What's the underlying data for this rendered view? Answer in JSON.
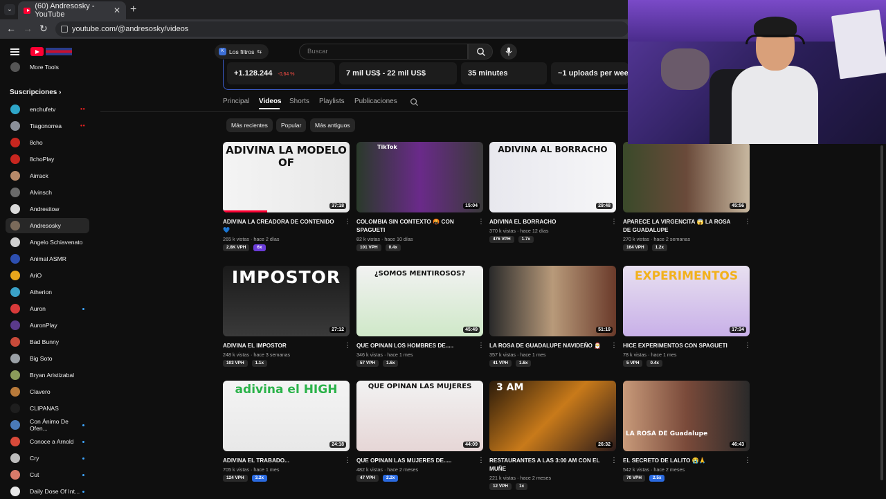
{
  "browser": {
    "tab_title": "(60) Andresosky - YouTube",
    "url": "youtube.com/@andresosky/videos"
  },
  "sidebar": {
    "more_tools": "More Tools",
    "subscriptions_title": "Suscripciones",
    "items": [
      {
        "label": "enchufetv",
        "avatar_color": "#2ea6c9",
        "live": true
      },
      {
        "label": "Tiagonorrea",
        "avatar_color": "#8a8f99",
        "live": true
      },
      {
        "label": "8cho",
        "avatar_color": "#c8261f"
      },
      {
        "label": "8choPlay",
        "avatar_color": "#c8261f"
      },
      {
        "label": "Airrack",
        "avatar_color": "#b88a6a"
      },
      {
        "label": "Alvinsch",
        "avatar_color": "#6a6a6a"
      },
      {
        "label": "Andresitow",
        "avatar_color": "#d9d9d9"
      },
      {
        "label": "Andresosky",
        "avatar_color": "#7a6a5a",
        "active": true
      },
      {
        "label": "Angelo Schiavenato",
        "avatar_color": "#cfcfcf"
      },
      {
        "label": "Animal ASMR",
        "avatar_color": "#2d4fb0"
      },
      {
        "label": "AriO",
        "avatar_color": "#e8a51c"
      },
      {
        "label": "Atherion",
        "avatar_color": "#3aa1c7"
      },
      {
        "label": "Auron",
        "avatar_color": "#d83a3a",
        "dot": true
      },
      {
        "label": "AuronPlay",
        "avatar_color": "#5a3a8a"
      },
      {
        "label": "Bad Bunny",
        "avatar_color": "#c84a3a"
      },
      {
        "label": "Big Soto",
        "avatar_color": "#9aa0a6"
      },
      {
        "label": "Bryan Aristizabal",
        "avatar_color": "#8a9a5a"
      },
      {
        "label": "Clavero",
        "avatar_color": "#b87a3a"
      },
      {
        "label": "CLIPANAS",
        "avatar_color": "#1e1e1e"
      },
      {
        "label": "Con Ánimo De Ofen...",
        "avatar_color": "#4a7ab8",
        "dot": true
      },
      {
        "label": "Conoce a Arnold",
        "avatar_color": "#d84a3a",
        "dot": true
      },
      {
        "label": "Cry",
        "avatar_color": "#bdbdbd",
        "dot": true
      },
      {
        "label": "Cut",
        "avatar_color": "#d87a6a",
        "dot": true
      },
      {
        "label": "Daily Dose Of Int...",
        "avatar_color": "#e8e8e8",
        "dot": true
      }
    ]
  },
  "topbar": {
    "filter_label": "Los filtros",
    "search_placeholder": "Buscar"
  },
  "stats": [
    {
      "value": "+1.128.244",
      "delta": "-0,64 %"
    },
    {
      "value": "7 mil US$ - 22 mil US$"
    },
    {
      "value": "35 minutes"
    },
    {
      "value": "~1 uploads per week"
    }
  ],
  "channel_tabs": [
    "Principal",
    "Videos",
    "Shorts",
    "Playlists",
    "Publicaciones"
  ],
  "active_tab": "Videos",
  "sort_chips": [
    "Más recientes",
    "Popular",
    "Más antiguos"
  ],
  "colors": {
    "accent_red": "#ff0033",
    "link_blue": "#3ea6ff",
    "badge_dark": "#2a2a2a",
    "badge_purple": "#6a3cd8",
    "badge_blue": "#2a6ae0"
  },
  "videos": [
    {
      "title": "ADIVINA LA CREADORA DE CONTENIDO 💙",
      "views": "265 k vistas",
      "age": "hace 2 días",
      "vph": "2.8K VPH",
      "mult": "6x",
      "mult_color": "#6a3cd8",
      "duration": "37:18",
      "progress": 0.35,
      "caption": "ADIVINA LA MODELO OF"
    },
    {
      "title": "COLOMBIA SIN CONTEXTO 🤬 CON SPAGUETI",
      "views": "82 k vistas",
      "age": "hace 10 días",
      "vph": "101 VPH",
      "mult": "0.4x",
      "mult_color": "#2a2a2a",
      "duration": "15:04",
      "progress": 0.0,
      "caption": "TikTok"
    },
    {
      "title": "ADIVINA EL BORRACHO",
      "views": "370 k vistas",
      "age": "hace 12 días",
      "vph": "476 VPH",
      "mult": "1.7x",
      "mult_color": "#2a2a2a",
      "duration": "29:48",
      "progress": 0.0,
      "caption": "ADIVINA AL BORRACHO"
    },
    {
      "title": "APARECE LA VIRGENCITA 😱 LA ROSA DE GUADALUPE",
      "views": "270 k vistas",
      "age": "hace 2 semanas",
      "vph": "164 VPH",
      "mult": "1.2x",
      "mult_color": "#2a2a2a",
      "duration": "45:56",
      "progress": 0.0,
      "caption": ""
    },
    {
      "title": "ADIVINA EL IMPOSTOR",
      "views": "248 k vistas",
      "age": "hace 3 semanas",
      "vph": "103 VPH",
      "mult": "1.1x",
      "mult_color": "#2a2a2a",
      "duration": "27:12",
      "progress": 0.0,
      "caption": "IMPOSTOR"
    },
    {
      "title": "QUE OPINAN LOS HOMBRES DE.....",
      "views": "346 k vistas",
      "age": "hace 1 mes",
      "vph": "57 VPH",
      "mult": "1.6x",
      "mult_color": "#2a2a2a",
      "duration": "45:49",
      "progress": 0.0,
      "caption": "¿SOMOS MENTIROSOS?"
    },
    {
      "title": "LA ROSA DE GUADALUPE NAVIDEÑO 🎅",
      "views": "357 k vistas",
      "age": "hace 1 mes",
      "vph": "41 VPH",
      "mult": "1.6x",
      "mult_color": "#2a2a2a",
      "duration": "51:19",
      "progress": 0.0,
      "caption": ""
    },
    {
      "title": "HICE EXPERIMENTOS CON SPAGUETI",
      "views": "78 k vistas",
      "age": "hace 1 mes",
      "vph": "5 VPH",
      "mult": "0.4x",
      "mult_color": "#2a2a2a",
      "duration": "17:34",
      "progress": 0.0,
      "caption": "EXPERIMENTOS"
    },
    {
      "title": "ADIVINA EL TRABADO...",
      "views": "705 k vistas",
      "age": "hace 1 mes",
      "vph": "124 VPH",
      "mult": "3.2x",
      "mult_color": "#2a6ae0",
      "duration": "24:18",
      "progress": 0.0,
      "caption": "adivina el HIGH"
    },
    {
      "title": "QUE OPINAN LAS MUJERES DE.....",
      "views": "482 k vistas",
      "age": "hace 2 meses",
      "vph": "47 VPH",
      "mult": "2.2x",
      "mult_color": "#2a6ae0",
      "duration": "44:09",
      "progress": 0.0,
      "caption": "QUE OPINAN LAS MUJERES"
    },
    {
      "title": "RESTAURANTES A LAS 3:00 AM CON EL MUÑE",
      "views": "221 k vistas",
      "age": "hace 2 meses",
      "vph": "12 VPH",
      "mult": "1x",
      "mult_color": "#2a2a2a",
      "duration": "26:32",
      "progress": 0.0,
      "caption": "3 AM"
    },
    {
      "title": "EL SECRETO DE LALITO 😭🙏",
      "views": "542 k vistas",
      "age": "hace 2 meses",
      "vph": "70 VPH",
      "mult": "2.5x",
      "mult_color": "#2a6ae0",
      "duration": "46:43",
      "progress": 0.0,
      "caption": "LA ROSA DE Guadalupe"
    }
  ]
}
